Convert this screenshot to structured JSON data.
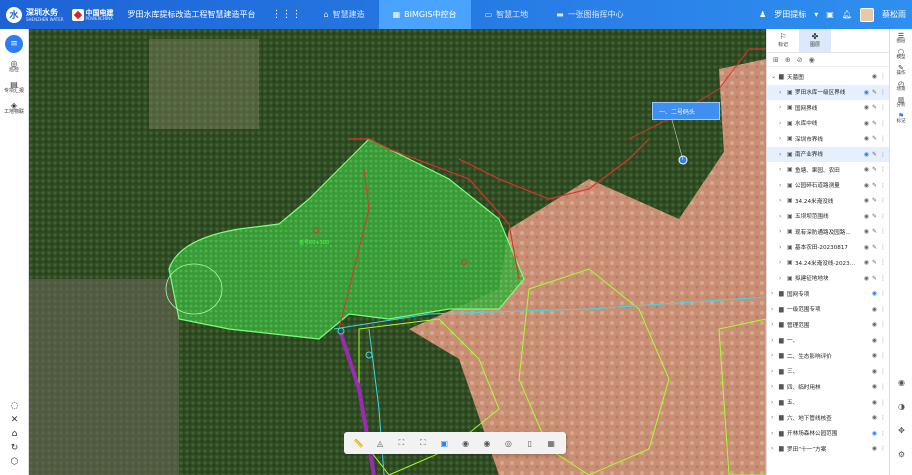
{
  "header": {
    "logo_mark": "水",
    "logo_text": "深圳水务",
    "logo_sub": "SHENZHEN WATER",
    "partner_text": "中国电建",
    "partner_sub": "POWERCHINA",
    "system_title": "罗田水库提标改造工程智慧建造平台",
    "apps_icon": "⋮⋮⋮",
    "nav": [
      {
        "icon": "⌂",
        "label": "智慧建造"
      },
      {
        "icon": "▦",
        "label": "BIMGIS中控台"
      },
      {
        "icon": "▭",
        "label": "智慧工地"
      },
      {
        "icon": "▬",
        "label": "一张图指挥中心"
      }
    ],
    "project_selector": "罗田提标",
    "user_name": "蔡松雨"
  },
  "left_rail": {
    "top_icon": "≡",
    "items": [
      {
        "icon": "◎",
        "label": "巡检"
      },
      {
        "icon": "▤",
        "label": "专项汇报"
      },
      {
        "icon": "◈",
        "label": "工地物联"
      }
    ],
    "bottom_icons": [
      "◌",
      "✕",
      "⌂",
      "↻",
      "⬡"
    ]
  },
  "map": {
    "callout_label": "一、二号码头",
    "area_label": "桩号K0+300"
  },
  "toolbar": {
    "tools": [
      "📏",
      "◬",
      "⛶",
      "⛶",
      "▣",
      "◉",
      "◉",
      "◎",
      "▯",
      "▦"
    ],
    "active_index": 4
  },
  "layer_panel": {
    "tabs": [
      {
        "icon": "⚐",
        "label": "标记"
      },
      {
        "icon": "✤",
        "label": "图层"
      }
    ],
    "active_tab": 1,
    "tool_icons": [
      "⊞",
      "⊕",
      "⊘",
      "◉"
    ],
    "rows": [
      {
        "level": 0,
        "expanded": true,
        "label": "天墓图",
        "visible": false
      },
      {
        "level": 1,
        "expanded": false,
        "label": "罗田水库一级区界线",
        "visible": true,
        "selected": true
      },
      {
        "level": 1,
        "expanded": false,
        "label": "国网界线",
        "visible": false
      },
      {
        "level": 1,
        "expanded": false,
        "label": "水库中线",
        "visible": false
      },
      {
        "level": 1,
        "expanded": false,
        "label": "深圳市界线",
        "visible": false
      },
      {
        "level": 1,
        "expanded": false,
        "label": "南产业界线",
        "visible": true,
        "selected": true
      },
      {
        "level": 1,
        "expanded": false,
        "label": "鱼塘、果园、农田",
        "visible": false
      },
      {
        "level": 1,
        "expanded": false,
        "label": "公园碎石道路测量",
        "visible": false
      },
      {
        "level": 1,
        "expanded": false,
        "label": "34.24米淹没线",
        "visible": false
      },
      {
        "level": 1,
        "expanded": false,
        "label": "五坝坝范围线",
        "visible": false
      },
      {
        "level": 1,
        "expanded": false,
        "label": "现有深防通路及园路...",
        "visible": false
      },
      {
        "level": 1,
        "expanded": false,
        "label": "基本农田-20230817",
        "visible": false
      },
      {
        "level": 1,
        "expanded": false,
        "label": "34.24米淹没线-2023...",
        "visible": false
      },
      {
        "level": 1,
        "expanded": false,
        "label": "拟建征地地块",
        "visible": false
      },
      {
        "level": 0,
        "expanded": false,
        "label": "国网专项",
        "visible": true
      },
      {
        "level": 0,
        "expanded": false,
        "label": "一级范围专项",
        "visible": false
      },
      {
        "level": 0,
        "expanded": false,
        "label": "管理范围",
        "visible": false
      },
      {
        "level": 0,
        "expanded": false,
        "label": "一、",
        "visible": false
      },
      {
        "level": 0,
        "expanded": false,
        "label": "二、生态影响评价",
        "visible": false
      },
      {
        "level": 0,
        "expanded": false,
        "label": "三、",
        "visible": false
      },
      {
        "level": 0,
        "expanded": false,
        "label": "四、临时用林",
        "visible": false
      },
      {
        "level": 0,
        "expanded": false,
        "label": "五、",
        "visible": false
      },
      {
        "level": 0,
        "expanded": false,
        "label": "六、地下管线核查",
        "visible": false
      },
      {
        "level": 0,
        "expanded": false,
        "label": "开林场森林公园范围",
        "visible": true
      },
      {
        "level": 0,
        "expanded": false,
        "label": "罗田“十一”方案",
        "visible": false
      }
    ]
  },
  "right_rail": {
    "items": [
      {
        "icon": "☰",
        "label": "图层"
      },
      {
        "icon": "⬡",
        "label": "模型"
      },
      {
        "icon": "✎",
        "label": "操作"
      },
      {
        "icon": "◴",
        "label": "场景"
      },
      {
        "icon": "▥",
        "label": "分析"
      },
      {
        "icon": "⚑",
        "label": "标记"
      }
    ],
    "active_index": 5,
    "bottom_icons": [
      "◉",
      "◑",
      "✥",
      "⚙"
    ]
  },
  "colors": {
    "brand_blue": "#1d63d6",
    "active_blue": "#2b7df0",
    "green_zone": "#33cc33",
    "red_boundary": "#e0302a",
    "cyan_line": "#3fd7e8",
    "purple_line": "#9b2bb3"
  }
}
